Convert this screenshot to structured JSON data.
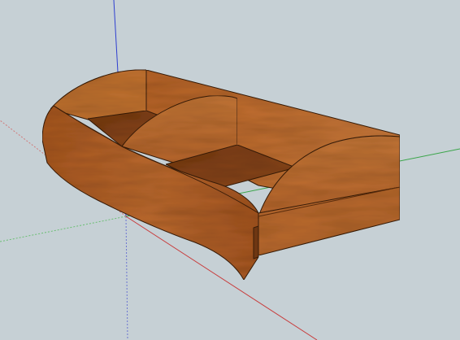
{
  "scene": {
    "model": "wooden-tray",
    "colors": {
      "background": "#c6d0d5",
      "wood_light": "#c97a3c",
      "wood_mid": "#b8652b",
      "wood_dark": "#8f4a1c",
      "wood_shadow": "#6e3612",
      "edge": "#3a1d08",
      "axis_red": "#c83a3a",
      "axis_green": "#3aa54a",
      "axis_blue": "#2f3fd0"
    }
  }
}
